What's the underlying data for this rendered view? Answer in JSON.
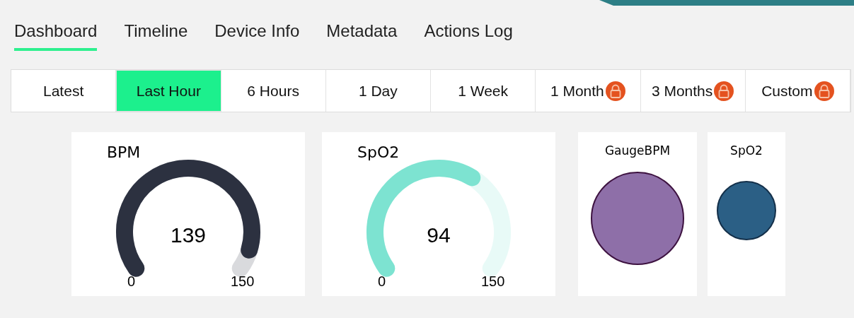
{
  "tabs": [
    {
      "label": "Dashboard",
      "selected": true
    },
    {
      "label": "Timeline",
      "selected": false
    },
    {
      "label": "Device Info",
      "selected": false
    },
    {
      "label": "Metadata",
      "selected": false
    },
    {
      "label": "Actions Log",
      "selected": false
    }
  ],
  "ranges": [
    {
      "label": "Latest",
      "selected": false,
      "locked": false
    },
    {
      "label": "Last Hour",
      "selected": true,
      "locked": false
    },
    {
      "label": "6 Hours",
      "selected": false,
      "locked": false
    },
    {
      "label": "1 Day",
      "selected": false,
      "locked": false
    },
    {
      "label": "1 Week",
      "selected": false,
      "locked": false
    },
    {
      "label": "1 Month",
      "selected": false,
      "locked": true
    },
    {
      "label": "3 Months",
      "selected": false,
      "locked": true
    },
    {
      "label": "Custom",
      "selected": false,
      "locked": true
    }
  ],
  "gauges": [
    {
      "title": "BPM",
      "value": "139",
      "min": "0",
      "max": "150",
      "color": "#2c3140"
    },
    {
      "title": "SpO2",
      "value": "94",
      "min": "0",
      "max": "150",
      "color": "#7de3d1"
    }
  ],
  "bubbles": [
    {
      "title": "GaugeBPM",
      "color": "#8e6fa8"
    },
    {
      "title": "SpO2",
      "color": "#2b5f85"
    }
  ]
}
